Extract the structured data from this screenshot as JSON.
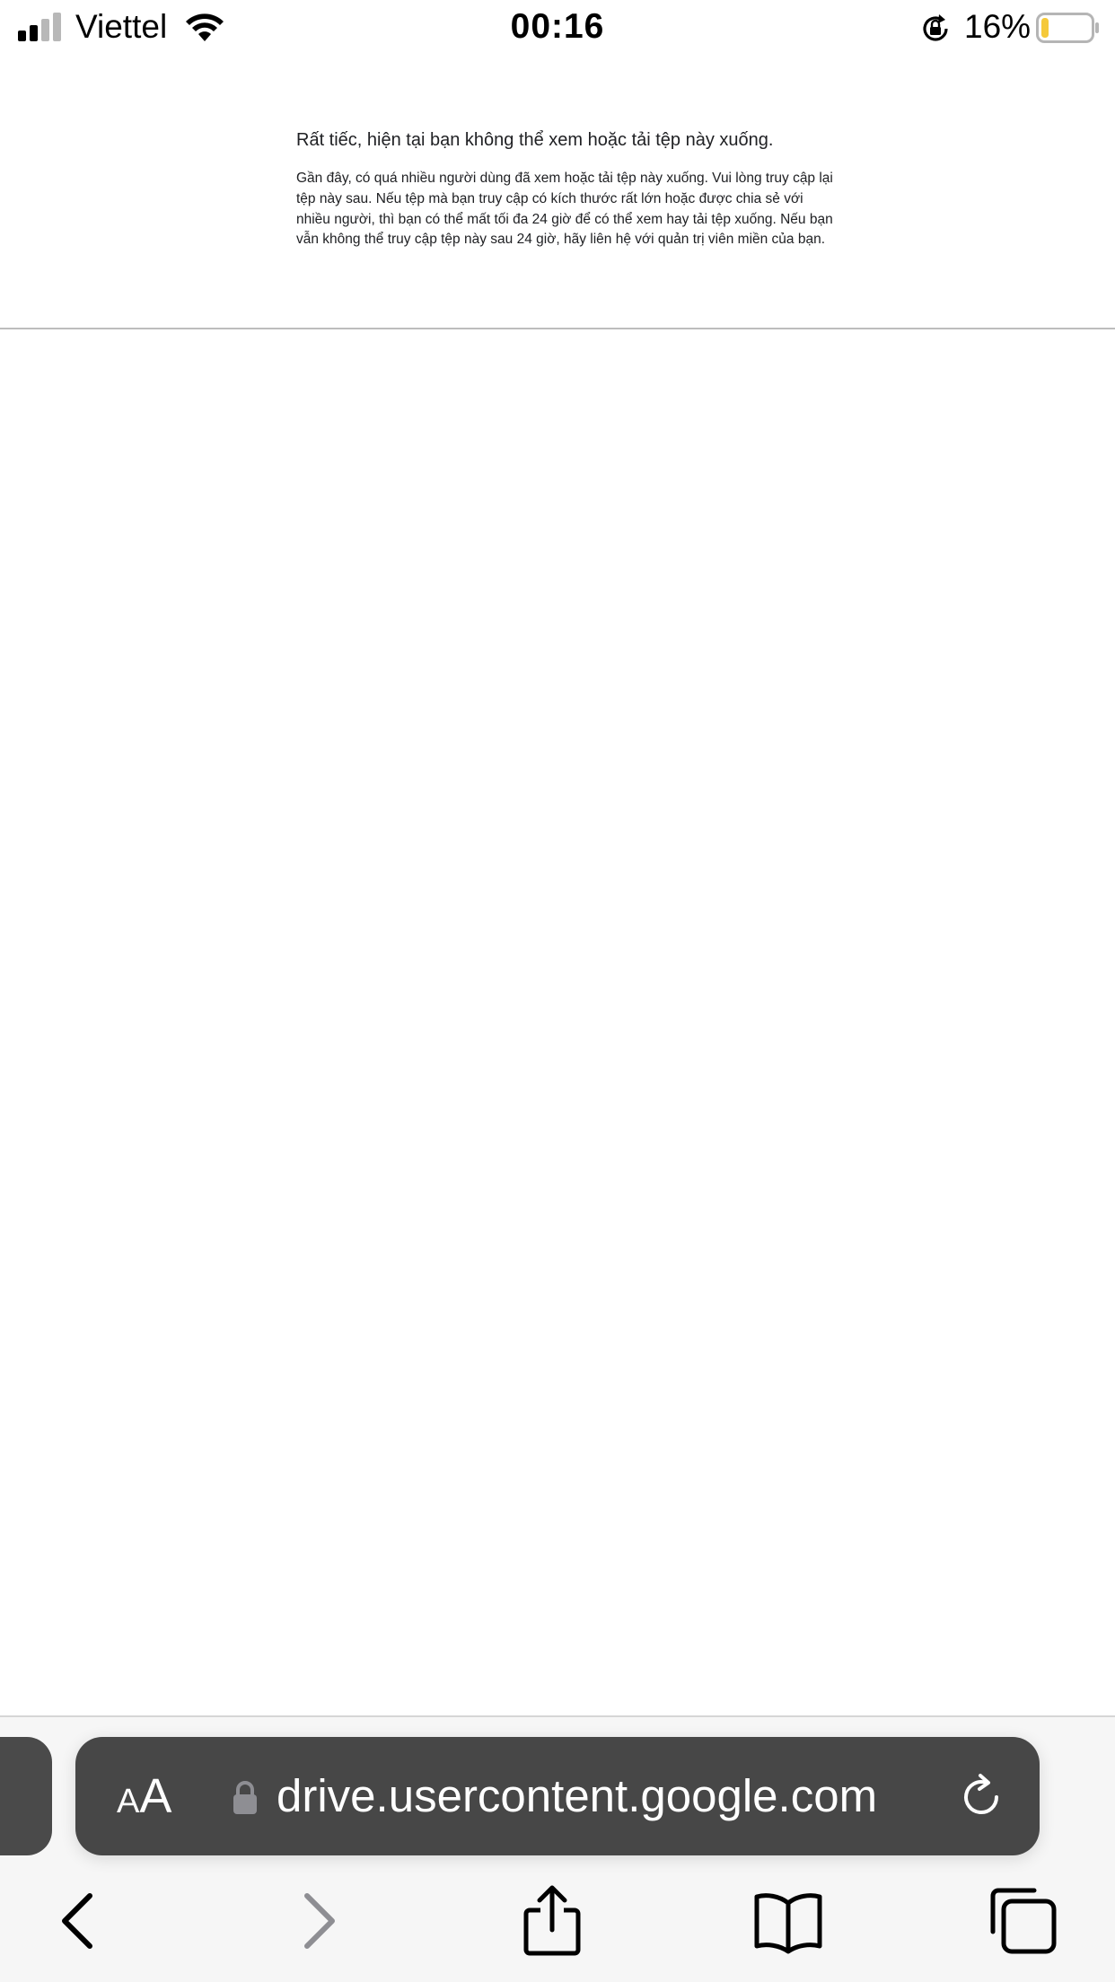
{
  "status_bar": {
    "carrier": "Viettel",
    "time": "00:16",
    "battery_percent": "16%",
    "battery_level": 0.16,
    "signal_bars_active": 2,
    "signal_bars_total": 4,
    "icons": [
      "signal-icon",
      "wifi-icon",
      "orientation-lock-icon",
      "battery-icon"
    ]
  },
  "page": {
    "title": "Rất tiếc, hiện tại bạn không thể xem hoặc tải tệp này xuống.",
    "body": "Gần đây, có quá nhiều người dùng đã xem hoặc tải tệp này xuống. Vui lòng truy cập lại tệp này sau. Nếu tệp mà bạn truy cập có kích thước rất lớn hoặc được chia sẻ với nhiều người, thì bạn có thể mất tối đa 24 giờ để có thể xem hay tải tệp xuống. Nếu bạn vẫn không thể truy cập tệp này sau 24 giờ, hãy liên hệ với quản trị viên miền của bạn."
  },
  "browser": {
    "aa_label_small": "A",
    "aa_label_large": "A",
    "url": "drive.usercontent.google.com",
    "toolbar_icons": [
      "back-icon",
      "forward-icon",
      "share-icon",
      "bookmarks-icon",
      "tabs-icon"
    ]
  },
  "colors": {
    "address_bar_bg": "#474747",
    "toolbar_bg": "#f6f6f6",
    "battery_fill": "#f5c93a",
    "forward_disabled": "#8e8e93"
  }
}
